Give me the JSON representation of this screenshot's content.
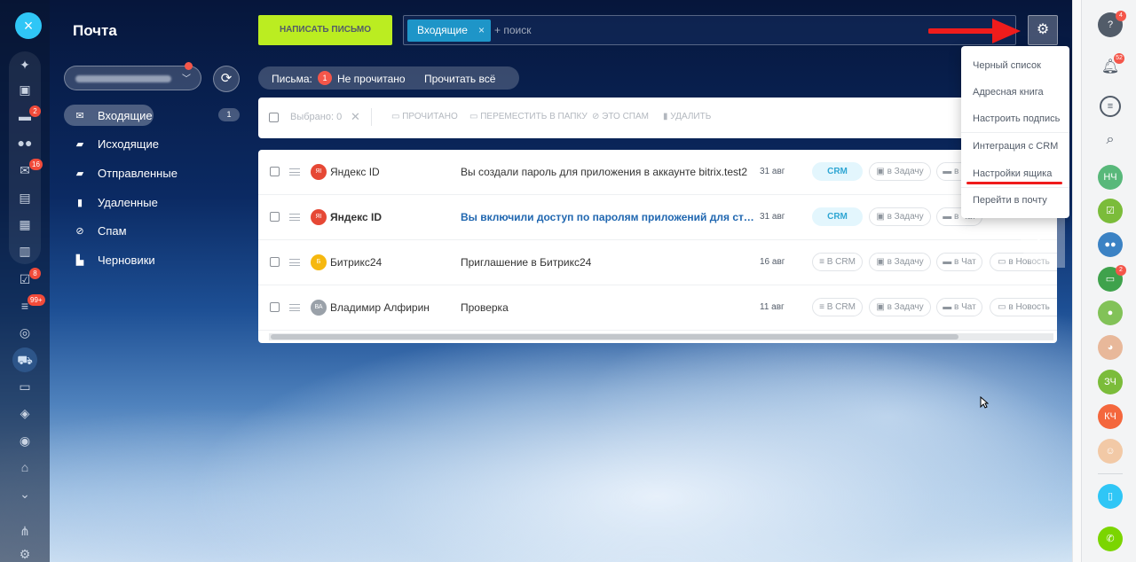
{
  "app": {
    "title": "Почта",
    "close_icon": "×"
  },
  "left_rail": {
    "badges": {
      "chat": "2",
      "mail": "16",
      "tasks": "8",
      "feed": "99+"
    }
  },
  "sidebar": {
    "refresh_icon": "⟳",
    "folders": [
      {
        "label": "Входящие",
        "count": "1",
        "icon": "envelope-icon"
      },
      {
        "label": "Исходящие",
        "icon": "folder-icon"
      },
      {
        "label": "Отправленные",
        "icon": "sent-icon"
      },
      {
        "label": "Удаленные",
        "icon": "trash-icon"
      },
      {
        "label": "Спам",
        "icon": "spam-icon"
      },
      {
        "label": "Черновики",
        "icon": "drafts-icon"
      }
    ]
  },
  "toolbar_top": {
    "compose_label": "НАПИСАТЬ ПИСЬМО",
    "filter_tag": "Входящие",
    "filter_tag_close": "×",
    "search_placeholder": "+ поиск"
  },
  "counters": {
    "label": "Письма:",
    "unread_count": "1",
    "unread_label": "Не прочитано",
    "read_all_label": "Прочитать всё"
  },
  "grid_toolbar": {
    "selected_label": "Выбрано: 0",
    "clear": "✕",
    "read_label": "ПРОЧИТАНО",
    "move_label": "ПЕРЕМЕСТИТЬ В ПАПКУ",
    "spam_label": "ЭТО СПАМ",
    "delete_label": "УДАЛИТЬ"
  },
  "messages": [
    {
      "avatar": "ЯI",
      "avatar_color": "#e64835",
      "from": "Яндекс ID",
      "subject": "Вы создали пароль для приложения в аккаунте bitrix.test2",
      "date": "31 авг",
      "crm": "CRM",
      "task": "в Задачу",
      "chat": "в Чат",
      "bold": false
    },
    {
      "avatar": "ЯI",
      "avatar_color": "#e64835",
      "from": "Яндекс ID",
      "subject": "Вы включили доступ по паролям приложений для сторонних",
      "date": "31 авг",
      "crm": "CRM",
      "task": "в Задачу",
      "chat": "в Чат",
      "bold": true
    },
    {
      "avatar": "Б",
      "avatar_color": "#f6b80f",
      "from": "Битрикс24",
      "subject": "Приглашение в Битрикс24",
      "date": "16 авг",
      "crm": "В CRM",
      "task": "в Задачу",
      "chat": "в Чат",
      "news": "в Новость",
      "bold": false
    },
    {
      "avatar": "ВА",
      "avatar_color": "#9aa1a9",
      "from": "Владимир Алфирин",
      "subject": "Проверка",
      "date": "11 авг",
      "crm": "В CRM",
      "task": "в Задачу",
      "chat": "в Чат",
      "news": "в Новость",
      "bold": false
    }
  ],
  "settings_menu": {
    "items": [
      "Черный список",
      "Адресная книга",
      "Настроить подпись",
      "Интеграция с CRM",
      "Настройки ящика",
      "Перейти в почту"
    ]
  },
  "right_rail": {
    "help_badge": "4",
    "notify_badge": "52",
    "avatars": [
      {
        "initials": "НЧ",
        "color": "#58b87a"
      },
      {
        "initials": "ЗЧ",
        "color": "#7bbc3a"
      },
      {
        "initials": "КЧ",
        "color": "#f4673d"
      }
    ],
    "group_badge": "2"
  },
  "colors": {
    "compose": "#bbed21",
    "accent": "#2fc6f6",
    "badge": "#f4564a",
    "annotation": "#ef1c1c"
  }
}
